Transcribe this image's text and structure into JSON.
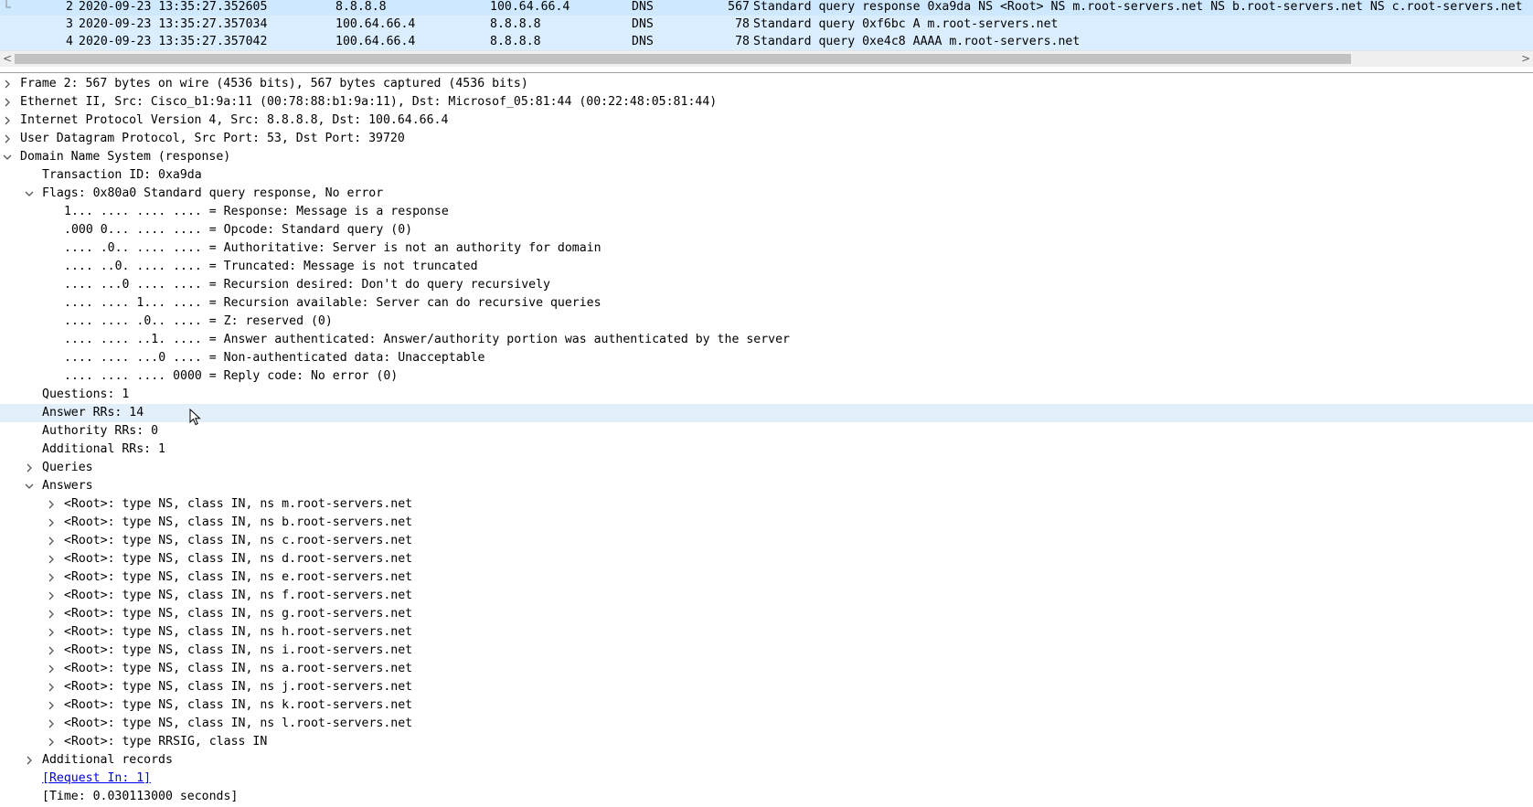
{
  "packet_list": {
    "rows": [
      {
        "no": "2",
        "time": "2020-09-23 13:35:27.352605",
        "source": "8.8.8.8",
        "destination": "100.64.66.4",
        "protocol": "DNS",
        "length": "567",
        "info": "Standard query response 0xa9da NS <Root> NS m.root-servers.net NS b.root-servers.net NS c.root-servers.net",
        "selected": true
      },
      {
        "no": "3",
        "time": "2020-09-23 13:35:27.357034",
        "source": "100.64.66.4",
        "destination": "8.8.8.8",
        "protocol": "DNS",
        "length": "78",
        "info": "Standard query 0xf6bc A m.root-servers.net",
        "selected": false
      },
      {
        "no": "4",
        "time": "2020-09-23 13:35:27.357042",
        "source": "100.64.66.4",
        "destination": "8.8.8.8",
        "protocol": "DNS",
        "length": "78",
        "info": "Standard query 0xe4c8 AAAA m.root-servers.net",
        "selected": false
      }
    ]
  },
  "scrollbar": {
    "left_arrow": "<",
    "right_arrow": ">"
  },
  "detail_tree": {
    "rows": [
      {
        "text": "Frame 2: 567 bytes on wire (4536 bits), 567 bytes captured (4536 bits)",
        "level": 0,
        "toggle": "collapsed"
      },
      {
        "text": "Ethernet II, Src: Cisco_b1:9a:11 (00:78:88:b1:9a:11), Dst: Microsof_05:81:44 (00:22:48:05:81:44)",
        "level": 0,
        "toggle": "collapsed"
      },
      {
        "text": "Internet Protocol Version 4, Src: 8.8.8.8, Dst: 100.64.66.4",
        "level": 0,
        "toggle": "collapsed"
      },
      {
        "text": "User Datagram Protocol, Src Port: 53, Dst Port: 39720",
        "level": 0,
        "toggle": "collapsed"
      },
      {
        "text": "Domain Name System (response)",
        "level": 0,
        "toggle": "expanded"
      },
      {
        "text": "Transaction ID: 0xa9da",
        "level": 1,
        "toggle": "none"
      },
      {
        "text": "Flags: 0x80a0 Standard query response, No error",
        "level": 1,
        "toggle": "expanded"
      },
      {
        "text": "1... .... .... .... = Response: Message is a response",
        "level": 2,
        "toggle": "none"
      },
      {
        "text": ".000 0... .... .... = Opcode: Standard query (0)",
        "level": 2,
        "toggle": "none"
      },
      {
        "text": ".... .0.. .... .... = Authoritative: Server is not an authority for domain",
        "level": 2,
        "toggle": "none"
      },
      {
        "text": ".... ..0. .... .... = Truncated: Message is not truncated",
        "level": 2,
        "toggle": "none"
      },
      {
        "text": ".... ...0 .... .... = Recursion desired: Don't do query recursively",
        "level": 2,
        "toggle": "none"
      },
      {
        "text": ".... .... 1... .... = Recursion available: Server can do recursive queries",
        "level": 2,
        "toggle": "none"
      },
      {
        "text": ".... .... .0.. .... = Z: reserved (0)",
        "level": 2,
        "toggle": "none"
      },
      {
        "text": ".... .... ..1. .... = Answer authenticated: Answer/authority portion was authenticated by the server",
        "level": 2,
        "toggle": "none"
      },
      {
        "text": ".... .... ...0 .... = Non-authenticated data: Unacceptable",
        "level": 2,
        "toggle": "none"
      },
      {
        "text": ".... .... .... 0000 = Reply code: No error (0)",
        "level": 2,
        "toggle": "none"
      },
      {
        "text": "Questions: 1",
        "level": 1,
        "toggle": "none"
      },
      {
        "text": "Answer RRs: 14",
        "level": 1,
        "toggle": "none",
        "hovered": true
      },
      {
        "text": "Authority RRs: 0",
        "level": 1,
        "toggle": "none"
      },
      {
        "text": "Additional RRs: 1",
        "level": 1,
        "toggle": "none"
      },
      {
        "text": "Queries",
        "level": 1,
        "toggle": "collapsed"
      },
      {
        "text": "Answers",
        "level": 1,
        "toggle": "expanded"
      },
      {
        "text": "<Root>: type NS, class IN, ns m.root-servers.net",
        "level": 2,
        "toggle": "collapsed"
      },
      {
        "text": "<Root>: type NS, class IN, ns b.root-servers.net",
        "level": 2,
        "toggle": "collapsed"
      },
      {
        "text": "<Root>: type NS, class IN, ns c.root-servers.net",
        "level": 2,
        "toggle": "collapsed"
      },
      {
        "text": "<Root>: type NS, class IN, ns d.root-servers.net",
        "level": 2,
        "toggle": "collapsed"
      },
      {
        "text": "<Root>: type NS, class IN, ns e.root-servers.net",
        "level": 2,
        "toggle": "collapsed"
      },
      {
        "text": "<Root>: type NS, class IN, ns f.root-servers.net",
        "level": 2,
        "toggle": "collapsed"
      },
      {
        "text": "<Root>: type NS, class IN, ns g.root-servers.net",
        "level": 2,
        "toggle": "collapsed"
      },
      {
        "text": "<Root>: type NS, class IN, ns h.root-servers.net",
        "level": 2,
        "toggle": "collapsed"
      },
      {
        "text": "<Root>: type NS, class IN, ns i.root-servers.net",
        "level": 2,
        "toggle": "collapsed"
      },
      {
        "text": "<Root>: type NS, class IN, ns a.root-servers.net",
        "level": 2,
        "toggle": "collapsed"
      },
      {
        "text": "<Root>: type NS, class IN, ns j.root-servers.net",
        "level": 2,
        "toggle": "collapsed"
      },
      {
        "text": "<Root>: type NS, class IN, ns k.root-servers.net",
        "level": 2,
        "toggle": "collapsed"
      },
      {
        "text": "<Root>: type NS, class IN, ns l.root-servers.net",
        "level": 2,
        "toggle": "collapsed"
      },
      {
        "text": "<Root>: type RRSIG, class IN",
        "level": 2,
        "toggle": "collapsed"
      },
      {
        "text": "Additional records",
        "level": 1,
        "toggle": "collapsed"
      },
      {
        "text": "[Request In: 1]",
        "level": 1,
        "toggle": "none",
        "link": true
      },
      {
        "text": "[Time: 0.030113000 seconds]",
        "level": 1,
        "toggle": "none"
      }
    ]
  },
  "colors": {
    "selected_row": "#cde8ff",
    "packet_row": "#daeeff",
    "hover_row": "#e3f0fb",
    "link": "#0000ee"
  },
  "icons": {
    "expanded": "chevron-down-icon",
    "collapsed": "chevron-right-icon",
    "cursor": "mouse-pointer-icon"
  }
}
